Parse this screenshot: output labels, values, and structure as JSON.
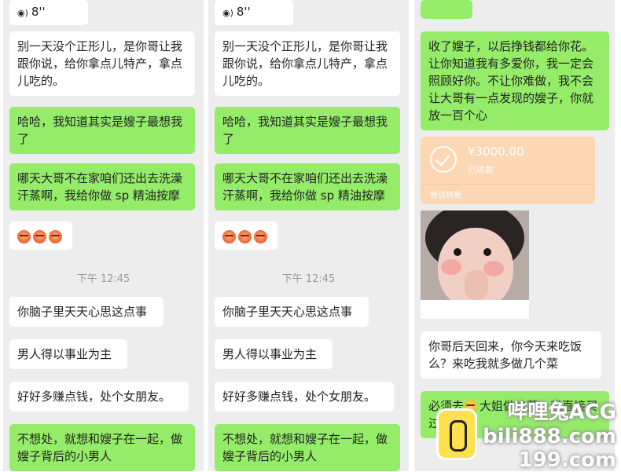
{
  "panels": [
    {
      "messages": [
        {
          "voice_duration": "8''"
        },
        {
          "text": "别一天没个正形儿，是你哥让我跟你说，给你拿点儿特产，拿点儿吃的。"
        },
        {
          "text": "哈哈，我知道其实是嫂子最想我了"
        },
        {
          "text": "哪天大哥不在家咱们还出去洗澡汗蒸啊，我给你做 sp 精油按摩"
        },
        {
          "emoji_count": 3
        },
        {
          "timestamp": "下午 12:45"
        },
        {
          "text": "你脑子里天天心思这点事"
        },
        {
          "text": "男人得以事业为主"
        },
        {
          "text": "好好多赚点钱，处个女朋友。"
        },
        {
          "text": "不想处，就想和嫂子在一起，做嫂子背后的小男人"
        }
      ]
    },
    {
      "messages": [
        {
          "voice_duration": "8''"
        },
        {
          "text": "别一天没个正形儿，是你哥让我跟你说，给你拿点儿特产，拿点儿吃的。"
        },
        {
          "text": "哈哈，我知道其实是嫂子最想我了"
        },
        {
          "text": "哪天大哥不在家咱们还出去洗澡汗蒸啊，我给你做 sp 精油按摩"
        },
        {
          "emoji_count": 3
        },
        {
          "timestamp": "下午 12:45"
        },
        {
          "text": "你脑子里天天心思这点事"
        },
        {
          "text": "男人得以事业为主"
        },
        {
          "text": "好好多赚点钱，处个女朋友。"
        },
        {
          "text": "不想处，就想和嫂子在一起，做嫂子背后的小男人"
        }
      ]
    },
    {
      "messages": [
        {
          "text": "收了嫂子，以后挣钱都给你花。让你知道我有多爱你，我一定会照顾好你。不让你难做，我不会让大哥有一点发现的嫂子，你就放一百个心"
        },
        {
          "transfer_amount": "¥3000.00",
          "transfer_status": "已收款",
          "transfer_label": "微信转账"
        },
        {
          "text": "你哥后天回来，你今天来吃饭么？来吃我就多做几个菜"
        },
        {
          "text_partial": "必须去",
          "text_partial2": "大姐做啥菜，我直接买过去"
        }
      ]
    }
  ],
  "watermark": {
    "line1": "哔哩兔ACG",
    "line2": "bili888.com",
    "line3": "199.com"
  },
  "colors": {
    "bg": "#ededed",
    "green_bubble": "#95ec69",
    "white_bubble": "#ffffff",
    "transfer": "#fbd7b4"
  }
}
